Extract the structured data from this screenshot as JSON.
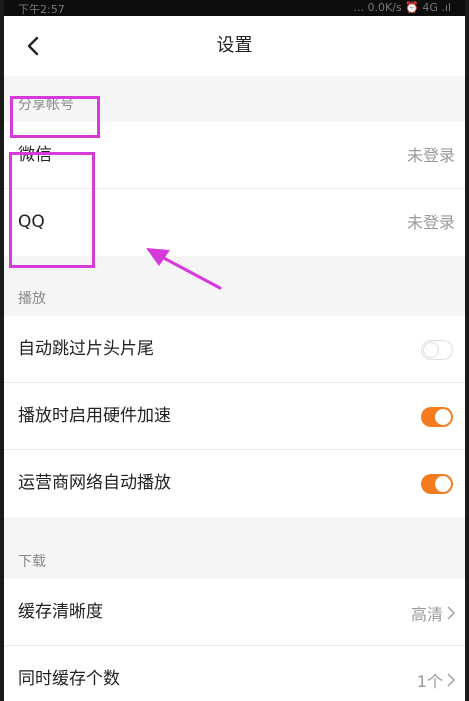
{
  "status_bar": {
    "left_text": "下午2:57",
    "right_text": "... 0.0K/s ⏰ 4G .ıl"
  },
  "navbar": {
    "title": "设置"
  },
  "sections": {
    "share_account": {
      "header": "分享帐号",
      "items": [
        {
          "label": "微信",
          "value": "未登录"
        },
        {
          "label": "QQ",
          "value": "未登录"
        }
      ]
    },
    "playback": {
      "header": "播放",
      "items": [
        {
          "label": "自动跳过片头片尾",
          "toggle": false
        },
        {
          "label": "播放时启用硬件加速",
          "toggle": true
        },
        {
          "label": "运营商网络自动播放",
          "toggle": true
        }
      ]
    },
    "download": {
      "header": "下载",
      "items": [
        {
          "label": "缓存清晰度",
          "value": "高清"
        },
        {
          "label": "同时缓存个数",
          "value": "1个"
        }
      ]
    }
  },
  "colors": {
    "accent": "#f47b20",
    "annotation": "#d63ad9"
  },
  "icons": {
    "back": "chevron-left-icon",
    "chevron": "chevron-right-icon"
  }
}
